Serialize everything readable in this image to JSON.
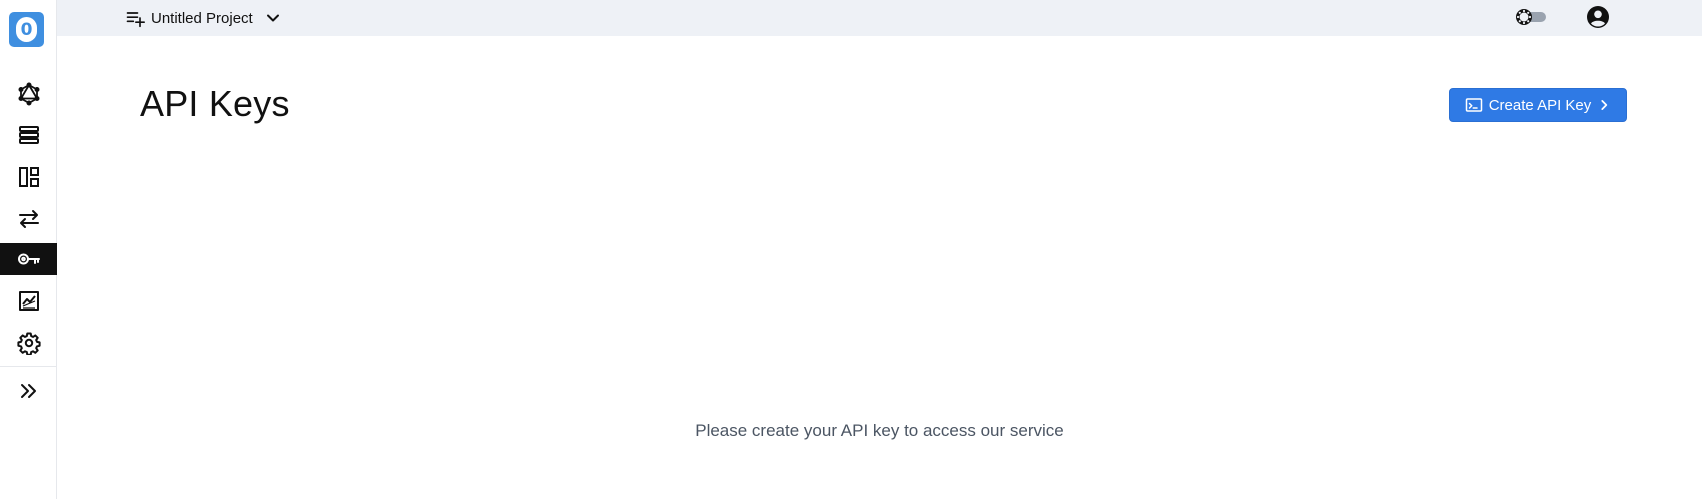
{
  "topbar": {
    "project_name": "Untitled Project"
  },
  "sidebar": {
    "logo_text": "0",
    "items": [
      {
        "name": "graphql",
        "icon": "graphql-icon",
        "active": false
      },
      {
        "name": "database",
        "icon": "database-icon",
        "active": false
      },
      {
        "name": "dashboard",
        "icon": "dashboard-icon",
        "active": false
      },
      {
        "name": "transfers",
        "icon": "arrows-exchange-icon",
        "active": false
      },
      {
        "name": "api-keys",
        "icon": "key-icon",
        "active": true
      },
      {
        "name": "analytics",
        "icon": "chart-icon",
        "active": false
      },
      {
        "name": "settings",
        "icon": "gear-icon",
        "active": false
      },
      {
        "name": "expand",
        "icon": "double-chevron-right-icon",
        "active": false
      }
    ]
  },
  "main": {
    "title": "API Keys",
    "create_button_label": "Create API Key",
    "empty_message": "Please create your API key to access our service"
  },
  "colors": {
    "accent": "#2f7ae5",
    "logo": "#3f8fe0",
    "topbar_bg": "#eef1f6",
    "active_nav_bg": "#111111"
  }
}
